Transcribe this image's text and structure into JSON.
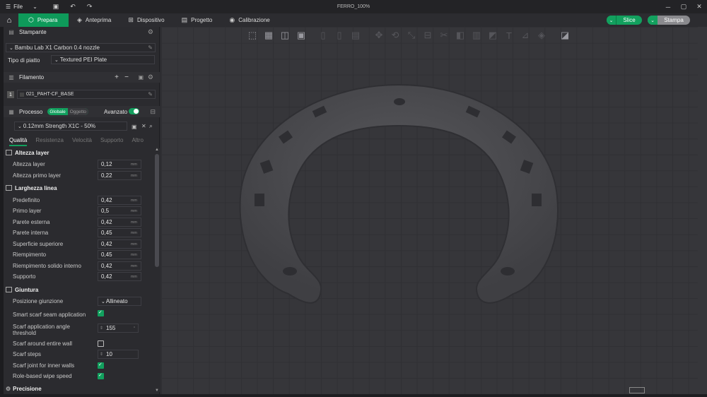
{
  "titlebar": {
    "menu_label": "File",
    "title": "FERRO_100%"
  },
  "nav": {
    "tabs": [
      {
        "label": "Prepara",
        "icon": "cube-icon"
      },
      {
        "label": "Anteprima",
        "icon": "layers-icon"
      },
      {
        "label": "Dispositivo",
        "icon": "device-icon"
      },
      {
        "label": "Progetto",
        "icon": "project-icon"
      },
      {
        "label": "Calibrazione",
        "icon": "calibration-icon"
      }
    ],
    "slice_label": "Slice",
    "print_label": "Stampa"
  },
  "printer": {
    "section_title": "Stampante",
    "printer_name": "Bambu Lab X1 Carbon 0.4 nozzle",
    "plate_label": "Tipo di piatto",
    "plate_value": "Textured PEI Plate"
  },
  "filament": {
    "section_title": "Filamento",
    "slot": "1",
    "name": "021_PAHT-CF_BASE"
  },
  "process": {
    "section_title": "Processo",
    "global_label": "Globale",
    "object_label": "Oggetto",
    "advanced_label": "Avanzato",
    "profile": "0.12mm Strength X1C - 50%",
    "tabs": [
      "Qualità",
      "Resistenza",
      "Velocità",
      "Supporto",
      "Altro"
    ]
  },
  "groups": {
    "layer_height": {
      "title": "Altezza layer",
      "rows": [
        {
          "label": "Altezza layer",
          "value": "0,12",
          "unit": "mm"
        },
        {
          "label": "Altezza primo layer",
          "value": "0,22",
          "unit": "mm"
        }
      ]
    },
    "line_width": {
      "title": "Larghezza linea",
      "rows": [
        {
          "label": "Predefinito",
          "value": "0,42",
          "unit": "mm"
        },
        {
          "label": "Primo layer",
          "value": "0,5",
          "unit": "mm"
        },
        {
          "label": "Parete esterna",
          "value": "0,42",
          "unit": "mm"
        },
        {
          "label": "Parete interna",
          "value": "0,45",
          "unit": "mm"
        },
        {
          "label": "Superficie superiore",
          "value": "0,42",
          "unit": "mm"
        },
        {
          "label": "Riempimento",
          "value": "0,45",
          "unit": "mm"
        },
        {
          "label": "Riempimento solido interno",
          "value": "0,42",
          "unit": "mm"
        },
        {
          "label": "Supporto",
          "value": "0,42",
          "unit": "mm"
        }
      ]
    },
    "seam": {
      "title": "Giuntura",
      "seam_position_label": "Posizione giunzione",
      "seam_position_value": "Allineato",
      "smart_scarf_label": "Smart scarf seam application",
      "scarf_angle_label": "Scarf application angle threshold",
      "scarf_angle_value": "155",
      "scarf_around_label": "Scarf around entire wall",
      "scarf_steps_label": "Scarf steps",
      "scarf_steps_value": "10",
      "scarf_inner_label": "Scarf joint for inner walls",
      "role_wipe_label": "Role-based wipe speed"
    },
    "precision": {
      "title": "Precisione"
    }
  },
  "colors": {
    "accent": "#12a05e",
    "background": "#36363a",
    "model": "#4a4a4e"
  }
}
